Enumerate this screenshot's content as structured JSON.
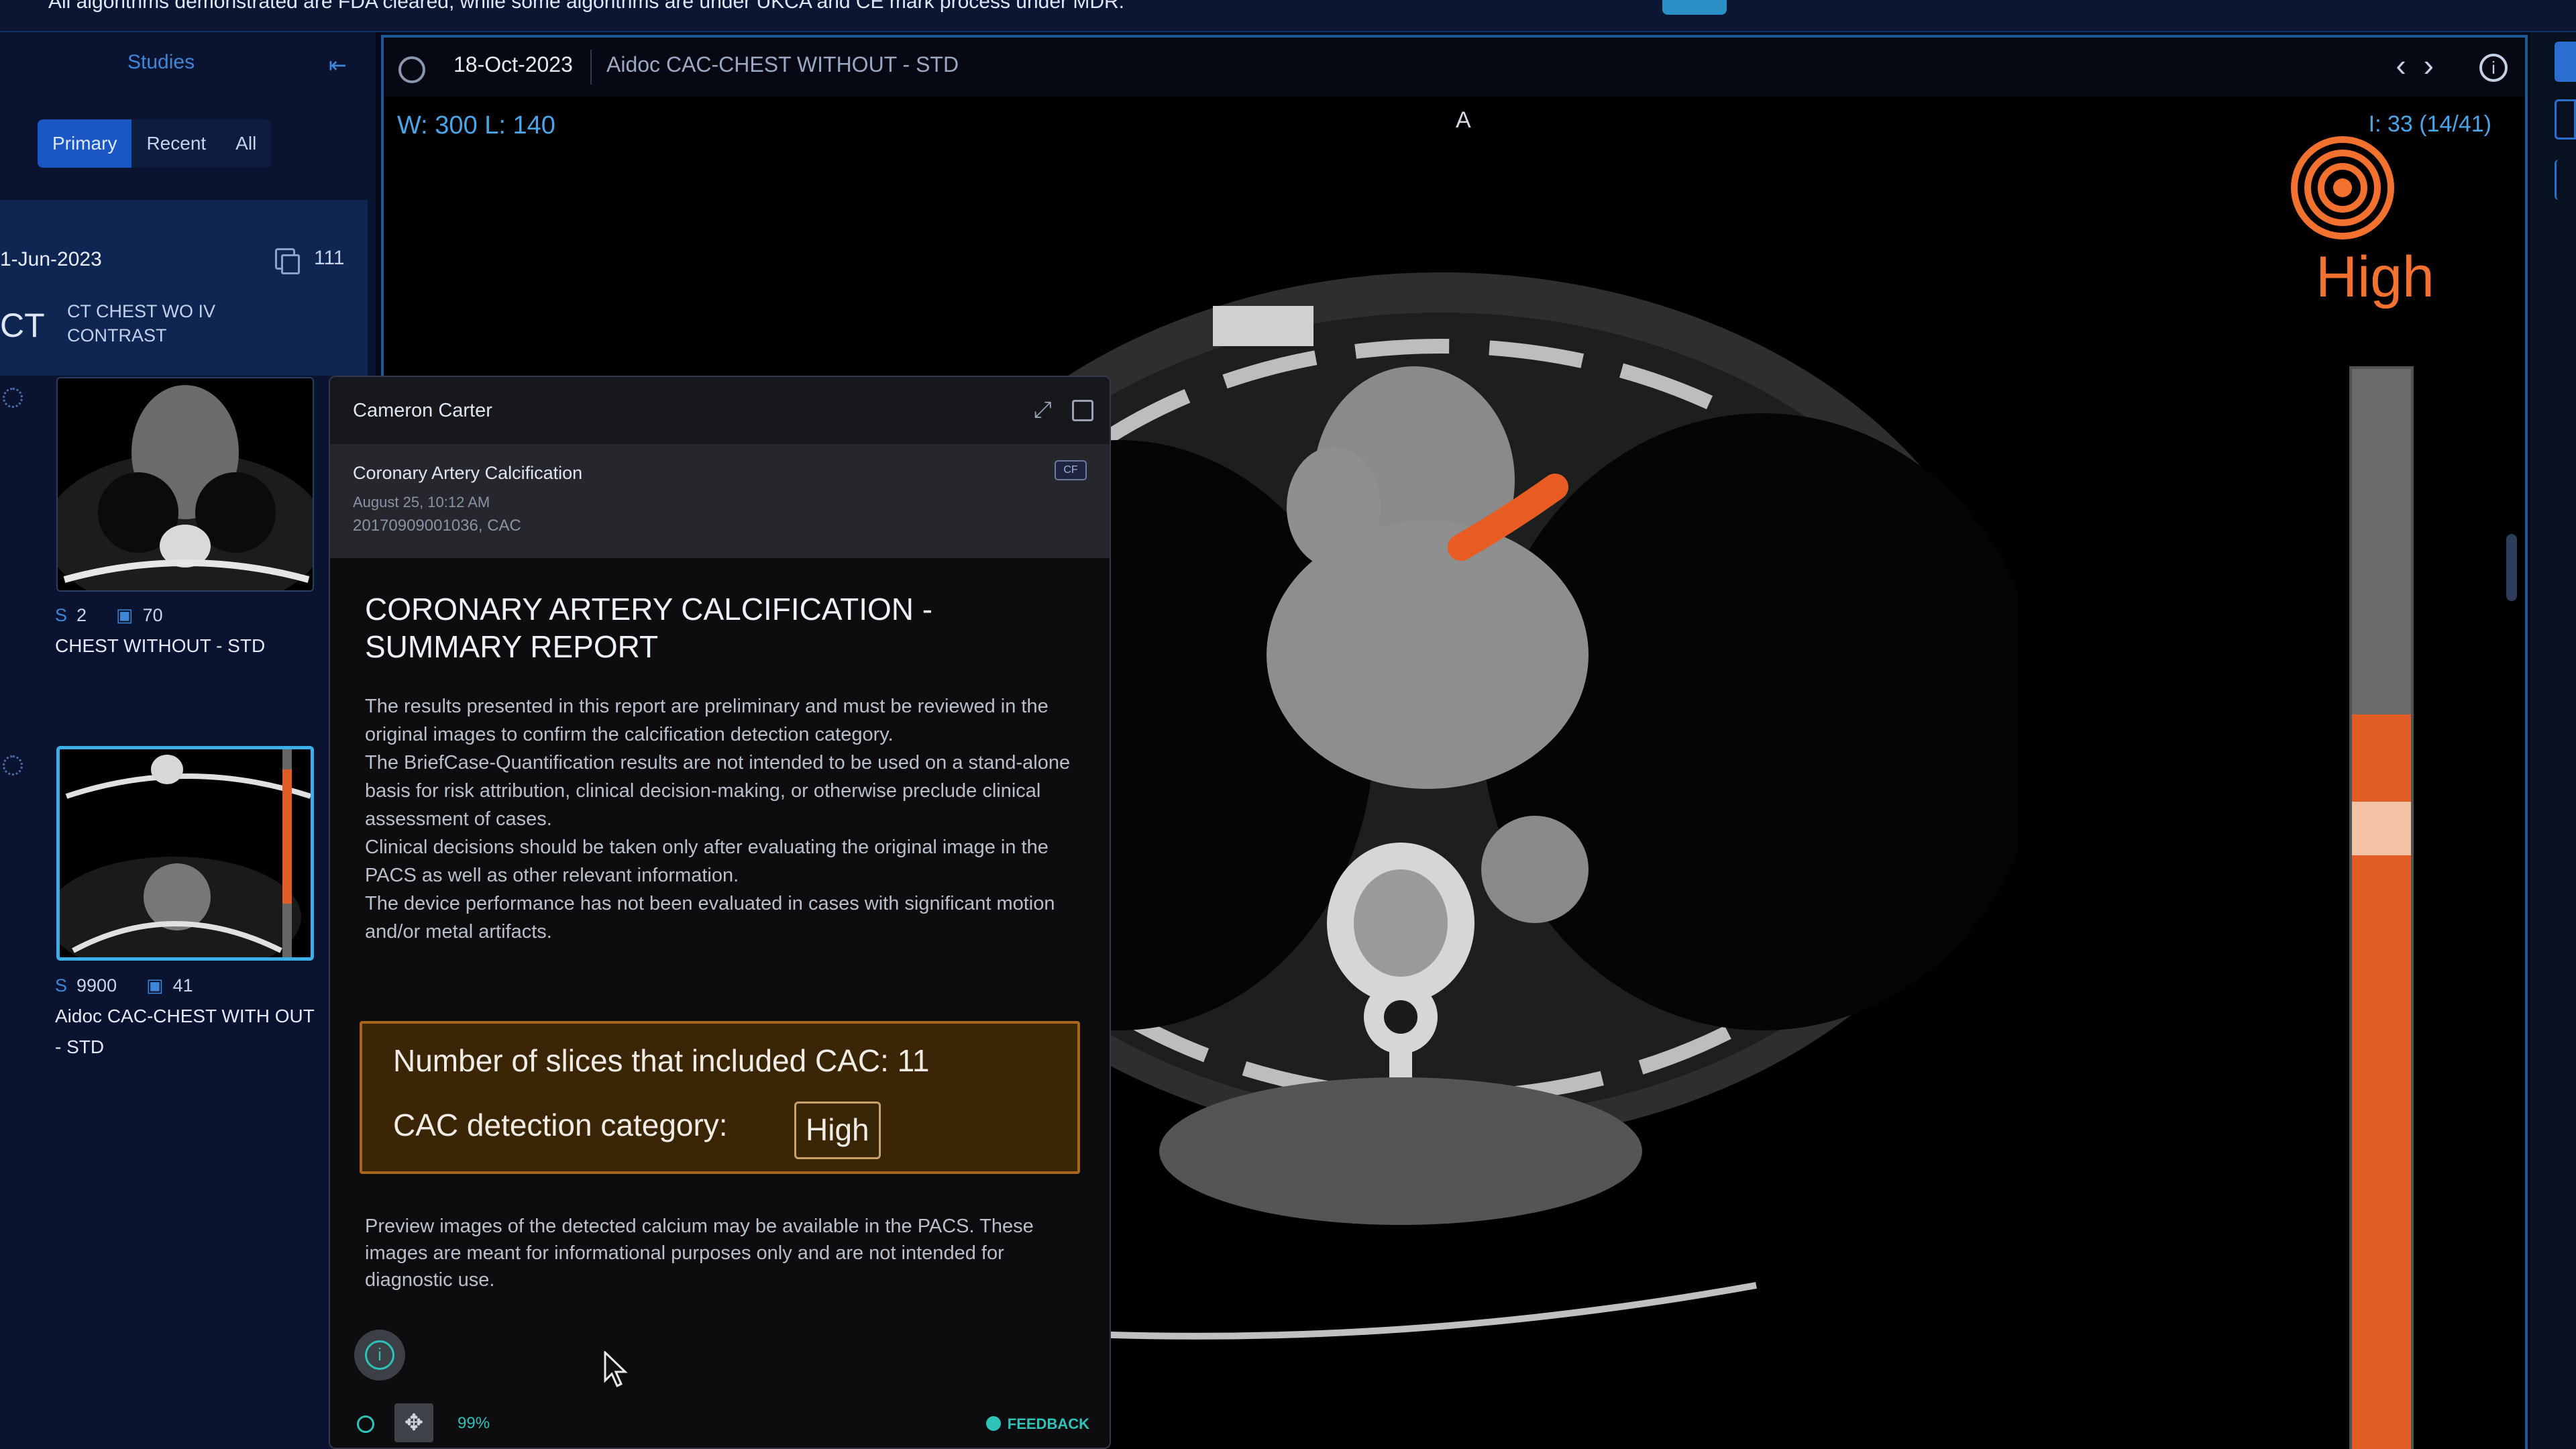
{
  "banner": {
    "text": "All algorithms demonstrated are FDA cleared, while some algorithms are under UKCA and CE mark process under MDR."
  },
  "sidebar": {
    "title": "Studies",
    "tabs": [
      {
        "label": "Primary",
        "active": true
      },
      {
        "label": "Recent",
        "active": false
      },
      {
        "label": "All",
        "active": false
      }
    ],
    "study": {
      "date": "1-Jun-2023",
      "image_count": "111",
      "modality": "CT",
      "description": "CT CHEST WO IV CONTRAST"
    },
    "series": [
      {
        "series_no": "2",
        "images": "70",
        "name": "CHEST WITHOUT - STD",
        "selected": false
      },
      {
        "series_no": "9900",
        "images": "41",
        "name": "Aidoc CAC-CHEST WITH OUT - STD",
        "selected": true
      }
    ]
  },
  "viewer": {
    "date": "18-Oct-2023",
    "series_title": "Aidoc CAC-CHEST WITHOUT - STD",
    "window_level": "W: 300 L: 140",
    "orientation": "A",
    "slice_info": "I: 33 (14/41)",
    "risk_label": "High",
    "risk_level_fraction": 0.68,
    "colors": {
      "accent": "#f2712f",
      "panel_border": "#1d5a95"
    }
  },
  "report": {
    "patient": "Cameron Carter",
    "algorithm": "Coronary Artery Calcification",
    "badge": "CF",
    "timestamp": "August 25, 10:12 AM",
    "accession": "20170909001036, CAC",
    "title": "CORONARY ARTERY CALCIFICATION - SUMMARY REPORT",
    "disclaimers": [
      "The results presented in this report are preliminary and must be reviewed in the original images to confirm the calcification detection category.",
      "The BriefCase-Quantification results are not intended to be used on a stand-alone basis for risk attribution, clinical decision-making, or otherwise preclude clinical assessment of cases.",
      "Clinical decisions should be taken only after evaluating the original image in the PACS as well as other relevant information.",
      "The device performance has not been evaluated in cases with significant motion and/or metal artifacts."
    ],
    "slices_line": "Number of slices that included CAC: 11",
    "category_label": "CAC detection category:",
    "category_value": "High",
    "preview_note": "Preview images of the detected calcium may be available in the PACS. These images are meant for informational purposes only and are not intended for diagnostic use.",
    "zoom": "99%",
    "feedback_label": "FEEDBACK"
  }
}
